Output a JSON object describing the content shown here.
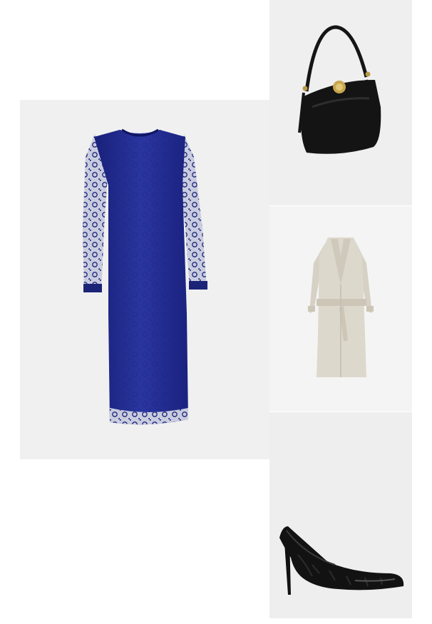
{
  "outfit": {
    "items": [
      {
        "id": "dress",
        "icon": "lace-dress-image",
        "color": "#1f2a86"
      },
      {
        "id": "bag",
        "icon": "shoulder-bag-image",
        "color": "#141414"
      },
      {
        "id": "coat",
        "icon": "trench-coat-image",
        "color": "#ddd8cc"
      },
      {
        "id": "shoe",
        "icon": "pump-shoe-image",
        "color": "#111111"
      }
    ]
  }
}
